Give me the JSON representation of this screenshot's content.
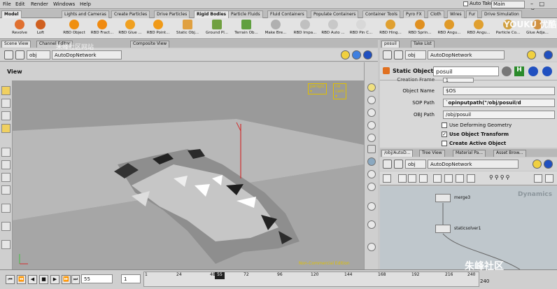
{
  "menu": {
    "items": [
      "File",
      "Edit",
      "Render",
      "Windows",
      "Help"
    ],
    "auto_takes": "Auto Takes",
    "desktop": "Main",
    "window_controls": "– □ ×"
  },
  "shelf_tabs": [
    "Model",
    "Lights and Cameras",
    "Create Particles",
    "Drive Particles",
    "Rigid Bodies",
    "Particle Fluids",
    "Fluid Containers",
    "Populate Containers",
    "Container Tools",
    "Pyro FX",
    "Cloth",
    "Wires",
    "Fur",
    "Drive Simulation"
  ],
  "shelf_tools": [
    "Revolve",
    "Loft",
    "RBD Object",
    "RBD Fract...",
    "RBD Glue ...",
    "RBD Point...",
    "Static Obj...",
    "Ground Pl...",
    "Terrain Ob...",
    "Make Bre...",
    "RBD Impa...",
    "RBD Auto ...",
    "RBD Pin C...",
    "RBD Hing...",
    "RBD Sprin...",
    "RBD Angu...",
    "RBD Angu...",
    "Particle Co...",
    "Glue Adja..."
  ],
  "viewport": {
    "tabs": [
      "Scene View",
      "Channel Editor",
      "Composite View"
    ],
    "path_obj": "obj",
    "path_node": "AutoDopNetwork",
    "title": "View",
    "cam_persp": "persp1 ▾",
    "cam_nocam": "no cam ▾",
    "noncommercial": "Non-Commercial Edition"
  },
  "params": {
    "tabs": [
      "posuil",
      "Take List"
    ],
    "path_obj": "obj",
    "path_node": "AutoDopNetwork",
    "node_type": "Static Object",
    "node_name": "posuil",
    "fields": [
      {
        "label": "Creation Frame",
        "value": "1"
      },
      {
        "label": "Object Name",
        "value": "$OS"
      },
      {
        "label": "SOP Path",
        "value": "`opinputpath(\"/obj/posuil/d"
      },
      {
        "label": "OBJ Path",
        "value": "/obj/posuil"
      }
    ],
    "checks": [
      {
        "label": "Use Deforming Geometry",
        "checked": ""
      },
      {
        "label": "Use Object Transform",
        "checked": "✓"
      },
      {
        "label": "Create Active Object",
        "checked": ""
      }
    ]
  },
  "network": {
    "tabs": [
      "/obj/AutoD...",
      "Tree View",
      "Material Pa...",
      "Asset Brow..."
    ],
    "path_obj": "obj",
    "path_node": "AutoDopNetwork",
    "context": "Dynamics",
    "nodes": [
      {
        "label": "merge3"
      },
      {
        "label": "staticsolver1"
      }
    ]
  },
  "timeline": {
    "frame": "55",
    "start": "1",
    "current": "55",
    "ticks": [
      "1",
      "24",
      "48",
      "72",
      "96",
      "120",
      "144",
      "168",
      "192",
      "216",
      "240"
    ],
    "end_label": "240"
  },
  "watermarks": {
    "youku": "YOUKU 优酷",
    "zhufeng": "朱峰社区",
    "site": "朱峰社区网站"
  }
}
